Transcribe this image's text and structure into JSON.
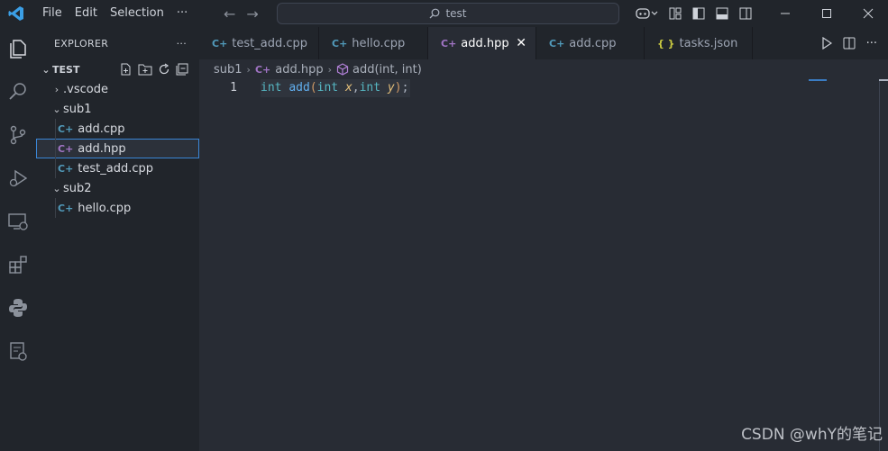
{
  "titlebar": {
    "menu": [
      "File",
      "Edit",
      "Selection",
      "···"
    ],
    "search_text": "test"
  },
  "explorer": {
    "title": "EXPLORER",
    "more": "···",
    "folder": "TEST",
    "tree": {
      "vscode": ".vscode",
      "sub1": "sub1",
      "add_cpp": "add.cpp",
      "add_hpp": "add.hpp",
      "test_add_cpp": "test_add.cpp",
      "sub2": "sub2",
      "hello_cpp": "hello.cpp"
    }
  },
  "tabs": {
    "t1": "test_add.cpp",
    "t2": "hello.cpp",
    "t3": "add.hpp",
    "t4": "add.cpp",
    "t5": "tasks.json",
    "close": "✕",
    "more": "···"
  },
  "breadcrumb": {
    "folder": "sub1",
    "file": "add.hpp",
    "symbol": "add(int, int)"
  },
  "editor": {
    "line_number": "1",
    "tokens": {
      "k1": "int",
      "fn": "add",
      "open": "(",
      "k2": "int",
      "p1": "x",
      "comma": ",",
      "k3": "int",
      "p2": "y",
      "close": ")",
      "semi": ";"
    }
  },
  "watermark": "CSDN @whY的笔记",
  "colors": {
    "accent": "#3a86d6",
    "cpp_icon": "#519aba",
    "hpp_icon": "#a074c4",
    "json_icon": "#cbcb41"
  }
}
